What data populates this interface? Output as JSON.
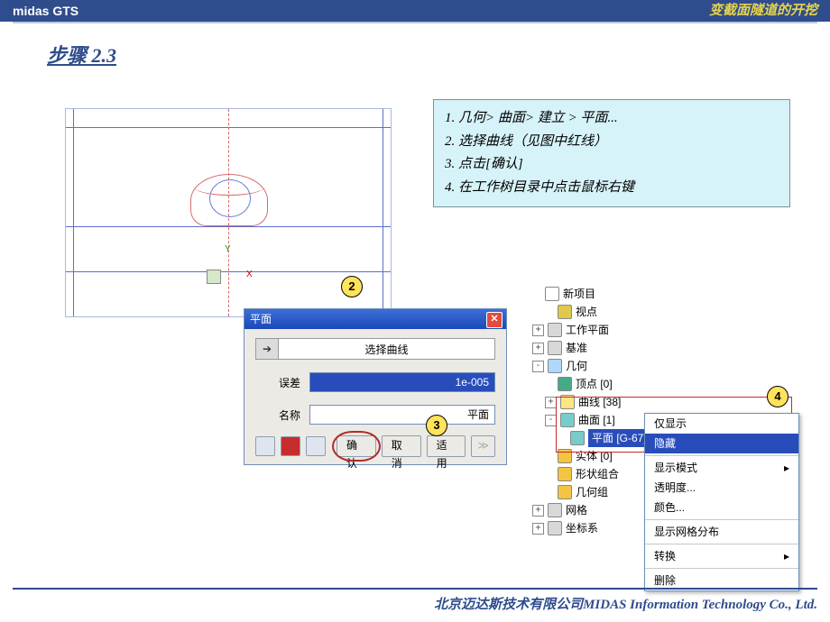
{
  "topbar": {
    "left": "midas GTS",
    "right": "变截面隧道的开挖"
  },
  "step_title": "步骤 2.3",
  "instructions": [
    "1. 几何> 曲面> 建立 > 平面...",
    "2. 选择曲线（见图中红线）",
    "3. 点击[确认]",
    "4. 在工作树目录中点击鼠标右键"
  ],
  "badges": {
    "b2": "2",
    "b3": "3",
    "b4": "4"
  },
  "dialog": {
    "title": "平面",
    "select_btn": "选择曲线",
    "tol_label": "误差",
    "tol_value": "1e-005",
    "name_label": "名称",
    "name_value": "平面",
    "ok": "确认",
    "cancel": "取消",
    "apply": "适用",
    "more": "≫"
  },
  "tree": {
    "n0": "新项目",
    "n1": "视点",
    "n2": "工作平面",
    "n3": "基准",
    "n4": "几何",
    "n4a": "顶点 [0]",
    "n4b": "曲线 [38]",
    "n4c": "曲面 [1]",
    "n4c1": "平面 [G-67]",
    "n4d": "实体 [0]",
    "n4e": "形状组合",
    "n4f": "几何组",
    "n5": "网格",
    "n6": "坐标系"
  },
  "ctx": {
    "only": "仅显示",
    "hide": "隐藏",
    "dispmode": "显示模式",
    "trans": "透明度...",
    "color": "颜色...",
    "meshdist": "显示网格分布",
    "convert": "转换",
    "delete": "删除"
  },
  "footer": "北京迈达斯技术有限公司MIDAS Information Technology Co., Ltd."
}
